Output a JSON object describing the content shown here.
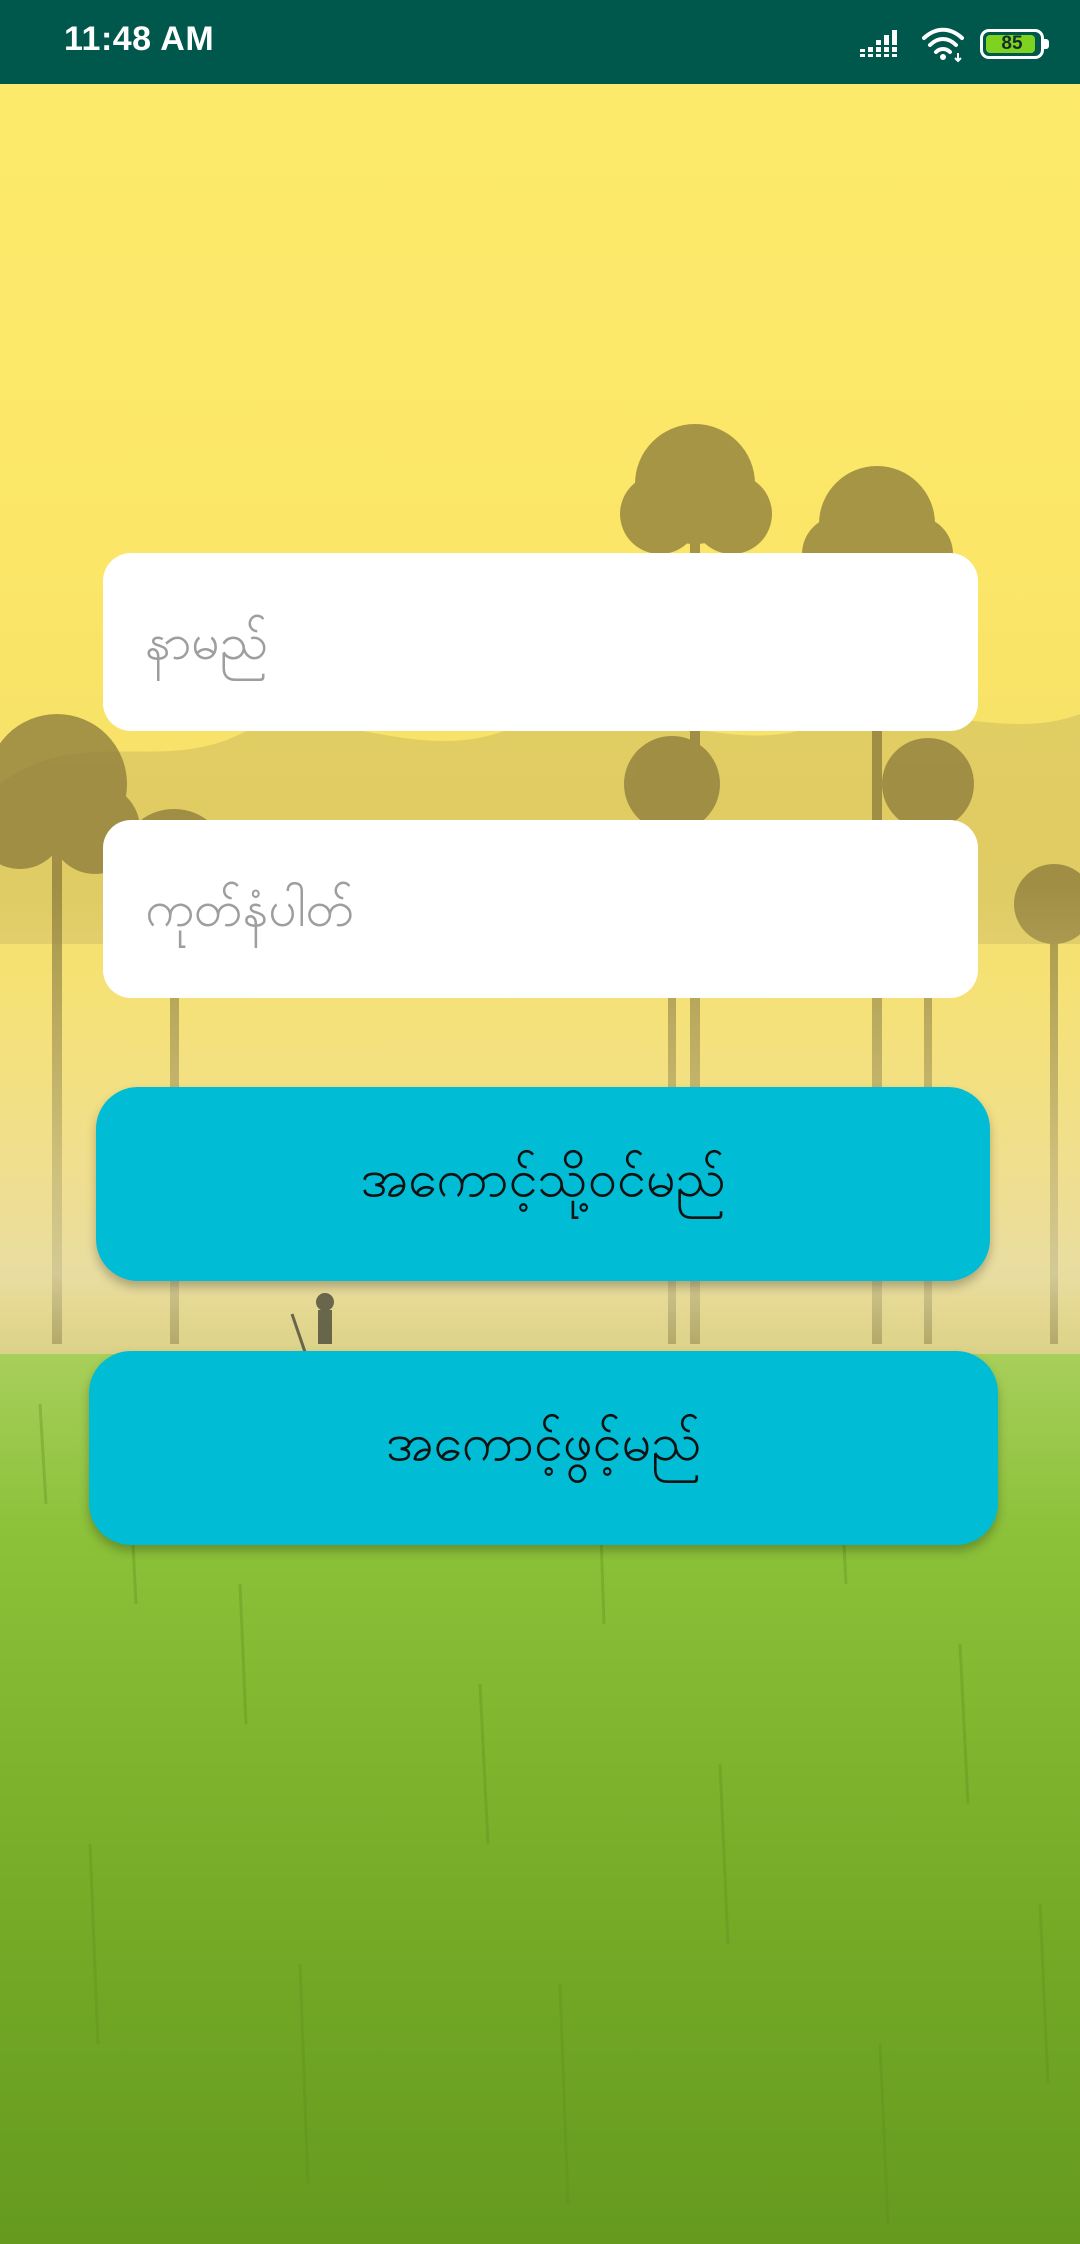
{
  "status_bar": {
    "time": "11:48 AM",
    "battery_level": "85",
    "icons": [
      "signal-icon",
      "wifi-icon",
      "battery-icon"
    ],
    "background_color": "#00574b"
  },
  "form": {
    "name_field": {
      "placeholder": "နာမည်",
      "value": ""
    },
    "password_field": {
      "placeholder": "ကုတ်နံပါတ်",
      "value": ""
    }
  },
  "buttons": {
    "login_label": "အကောင့်သို့ဝင်မည်",
    "register_label": "အကောင့်ဖွင့်မည်",
    "color": "#00bcd4"
  },
  "background": {
    "image": "rice-field-scene"
  }
}
